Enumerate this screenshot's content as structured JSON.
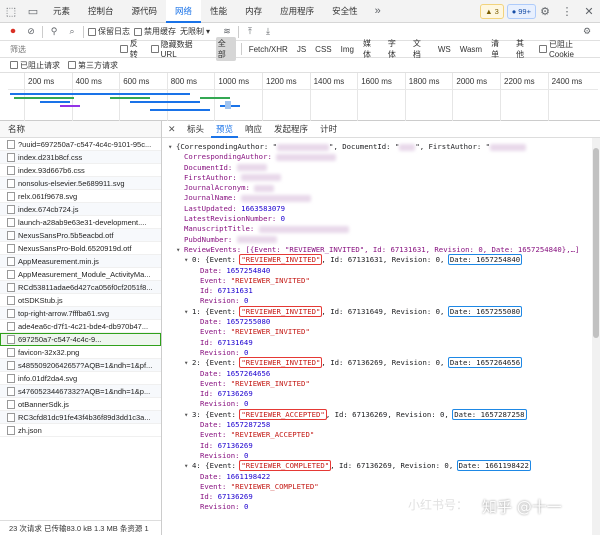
{
  "tabs": [
    "元素",
    "控制台",
    "源代码",
    "网络",
    "性能",
    "内存",
    "应用程序",
    "安全性"
  ],
  "active_tab": "网络",
  "badges": {
    "warnings": "3",
    "issues": "99+"
  },
  "toolbar": {
    "preserve_log": "保留日志",
    "disable_cache": "禁用缓存",
    "throttle": "无限制"
  },
  "filter": {
    "placeholder": "筛选",
    "invert": "反转",
    "hide_data_urls": "隐藏数据 URL",
    "types": [
      "全部",
      "Fetch/XHR",
      "JS",
      "CSS",
      "Img",
      "媒体",
      "字体",
      "文档",
      "WS",
      "Wasm",
      "清单",
      "其他"
    ],
    "blocked_cookies": "已阻止 Cookie",
    "blocked_requests": "已阻止请求",
    "third_party": "第三方请求"
  },
  "timeline_ticks": [
    "200 ms",
    "400 ms",
    "600 ms",
    "800 ms",
    "1000 ms",
    "1200 ms",
    "1400 ms",
    "1600 ms",
    "1800 ms",
    "2000 ms",
    "2200 ms",
    "2400 ms"
  ],
  "left_panel": {
    "header": "名称",
    "rows": [
      "?uuid=697250a7-c547-4c4c-9101-95c...",
      "index.d231b8cf.css",
      "index.93d667b6.css",
      "nonsolus-elsevier.5e689911.svg",
      "relx.061f9678.svg",
      "index.674cb724.js",
      "launch-a28ab9e63e31-development....",
      "NexusSansPro.5b5eacbd.otf",
      "NexusSansPro-Bold.6520919d.otf",
      "AppMeasurement.min.js",
      "AppMeasurement_Module_ActivityMa...",
      "RCd53811adae6d427ca056f0cf2051f8...",
      "otSDKStub.js",
      "top-right-arrow.7fffba61.svg",
      "ade4ea6c-d7f1-4c21-bde4-db970b47...",
      "697250a7-c547-4c4c-9...",
      "favicon-32x32.png",
      "s48550920642657?AQB=1&ndh=1&pf...",
      "info.01df2da4.svg",
      "s47605234467332?AQB=1&ndh=1&p...",
      "otBannerSdk.js",
      "RC3cfd81dc91fe43f4b36f89d3dd1c3a...",
      "zh.json"
    ],
    "status": "23 次请求  已传输83.0 kB  1.3 MB 条资源  1"
  },
  "detail_tabs": [
    "标头",
    "预览",
    "响应",
    "发起程序",
    "计时"
  ],
  "active_detail_tab": "预览",
  "preview": {
    "root": "{CorrespondingAuthor: \"",
    "root_doc": "\", DocumentId: \"",
    "root_first": "\", FirstAuthor: \"",
    "fields": {
      "corresponding_author": "CorrespondingAuthor: ",
      "document_id": "DocumentId: ",
      "first_author": "FirstAuthor: ",
      "journal_acronym": "JournalAcronym: ",
      "journal_name": "JournalName: ",
      "last_updated_key": "LastUpdated: ",
      "last_updated": "1663583079",
      "latest_revision_key": "LatestRevisionNumber: ",
      "latest_revision": "0",
      "manuscript_title": "ManuscriptTitle: ",
      "pub_number": "PubdNumber: "
    },
    "review_events_header": "ReviewEvents: [{Event: \"REVIEWER_INVITED\", Id: 67131631, Revision: 0, Date: 1657254840},…]",
    "events": [
      {
        "idx": "0",
        "event": "REVIEWER_INVITED",
        "id": "67131631",
        "revision": "0",
        "date": "1657254840"
      },
      {
        "idx": "1",
        "event": "REVIEWER_INVITED",
        "id": "67131649",
        "revision": "0",
        "date": "1657255080"
      },
      {
        "idx": "2",
        "event": "REVIEWER_INVITED",
        "id": "67136269",
        "revision": "0",
        "date": "1657264656"
      },
      {
        "idx": "3",
        "event": "REVIEWER_ACCEPTED",
        "id": "67136269",
        "revision": "0",
        "date": "1657287258"
      },
      {
        "idx": "4",
        "event": "REVIEWER_COMPLETED",
        "id": "67136269",
        "revision": "0",
        "date": "1661198422"
      }
    ]
  },
  "watermarks": {
    "xhs": "小红书号：",
    "zhihu": "知乎 @十一"
  }
}
